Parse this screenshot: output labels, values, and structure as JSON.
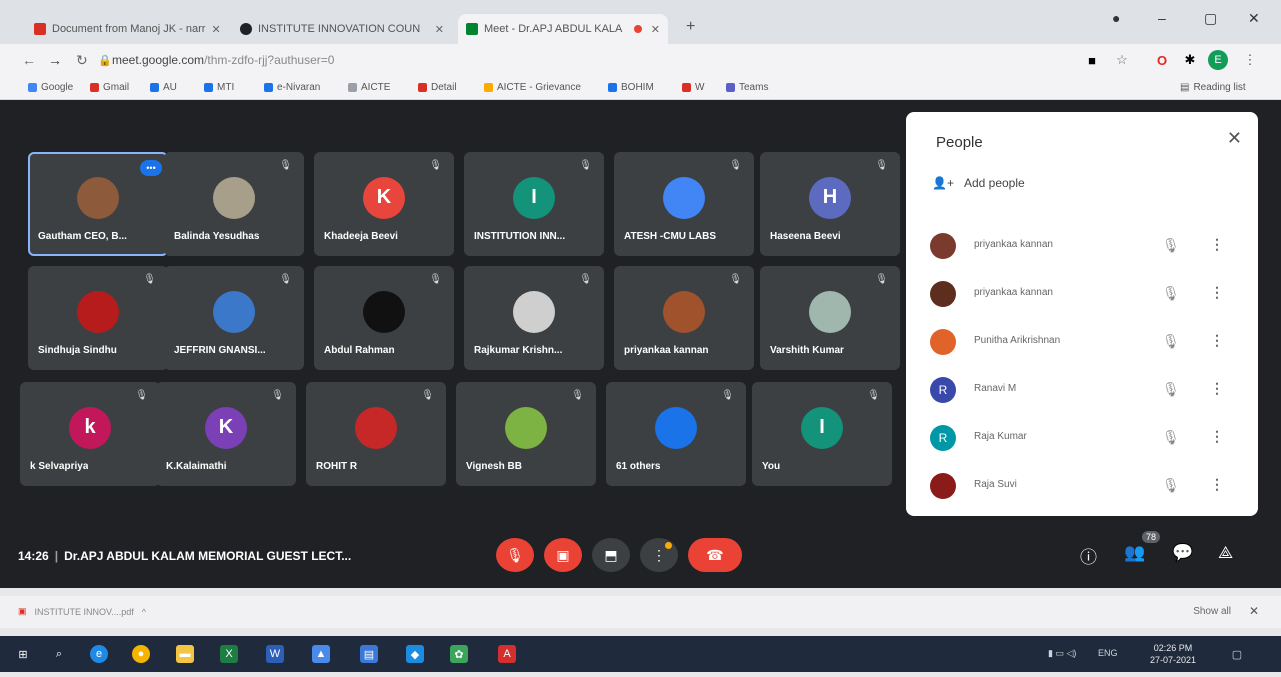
{
  "browser": {
    "tabs": [
      {
        "label": "Document from Manoj JK - narr",
        "favicon_color": "#d93025",
        "icon": "gmail-icon"
      },
      {
        "label": "INSTITUTE INNOVATION COUN",
        "favicon_color": "#202124",
        "icon": "github-icon"
      },
      {
        "label": "Meet - Dr.APJ ABDUL KALA",
        "favicon_color": "#00832d",
        "icon": "meet-icon"
      }
    ],
    "new_tab": "+",
    "window_controls": [
      "–",
      "▢",
      "✕"
    ],
    "url_host": "meet.google.com",
    "url_path": "/thm-zdfo-rjj?authuser=0",
    "profile_initial": "E",
    "reading_list": "Reading list",
    "bookmarks": [
      {
        "label": "Google",
        "color": "#4285f4"
      },
      {
        "label": "Gmail",
        "color": "#d93025"
      },
      {
        "label": "AU",
        "color": "#1a73e8"
      },
      {
        "label": "MTI",
        "color": "#1a73e8"
      },
      {
        "label": "e-Nivaran",
        "color": "#1a73e8"
      },
      {
        "label": "AICTE",
        "color": "#9aa0a6"
      },
      {
        "label": "Detail",
        "color": "#d93025"
      },
      {
        "label": "AICTE - Grievance",
        "color": "#f9ab00"
      },
      {
        "label": "BOHIM",
        "color": "#1a73e8"
      },
      {
        "label": "W",
        "color": "#d93025"
      },
      {
        "label": "Teams",
        "color": "#5b5fc7"
      }
    ]
  },
  "meet": {
    "tiles": [
      {
        "name": "Gautham CEO, B...",
        "initial": "",
        "avatar_color": "#8d5a3b",
        "self": true
      },
      {
        "name": "Balinda Yesudhas",
        "initial": "",
        "avatar_color": "#a89f8a"
      },
      {
        "name": "Khadeeja Beevi",
        "initial": "K",
        "avatar_color": "#e8453c"
      },
      {
        "name": "INSTITUTION INN...",
        "initial": "I",
        "avatar_color": "#12937a"
      },
      {
        "name": "ATESH -CMU LABS",
        "initial": "",
        "avatar_color": "#4285f4"
      },
      {
        "name": "Haseena Beevi",
        "initial": "H",
        "avatar_color": "#5c6bc0"
      },
      {
        "name": "Sindhuja Sindhu",
        "initial": "",
        "avatar_color": "#b71c1c"
      },
      {
        "name": "JEFFRIN GNANSI...",
        "initial": "",
        "avatar_color": "#3b78c9"
      },
      {
        "name": "Abdul Rahman",
        "initial": "",
        "avatar_color": "#111111"
      },
      {
        "name": "Rajkumar Krishn...",
        "initial": "",
        "avatar_color": "#cfcfcf"
      },
      {
        "name": "priyankaa kannan",
        "initial": "",
        "avatar_color": "#a0522d"
      },
      {
        "name": "Varshith Kumar",
        "initial": "",
        "avatar_color": "#9fb7ad"
      },
      {
        "name": "k Selvapriya",
        "initial": "k",
        "avatar_color": "#c2185b"
      },
      {
        "name": "K.Kalaimathi",
        "initial": "K",
        "avatar_color": "#7b3fb6"
      },
      {
        "name": "ROHIT R",
        "initial": "",
        "avatar_color": "#c62828"
      },
      {
        "name": "Vignesh BB",
        "initial": "",
        "avatar_color": "#7cb342"
      },
      {
        "name": "61 others",
        "initial": "",
        "avatar_color": "#1a73e8"
      },
      {
        "name": "You",
        "initial": "I",
        "avatar_color": "#12937a"
      }
    ],
    "more_options_badge": "•••",
    "time": "14:26",
    "meeting_title": "Dr.APJ ABDUL KALAM MEMORIAL GUEST LECT...",
    "people_count": "78"
  },
  "people_panel": {
    "title": "People",
    "add_people": "Add people",
    "participants": [
      {
        "name": "priyankaa kannan",
        "initial": "",
        "color": "#7a3b2e"
      },
      {
        "name": "priyankaa kannan",
        "initial": "",
        "color": "#5d2e1e"
      },
      {
        "name": "Punitha Arikrishnan",
        "initial": "",
        "color": "#e0632a"
      },
      {
        "name": "Ranavi M",
        "initial": "R",
        "color": "#3949ab"
      },
      {
        "name": "Raja Kumar",
        "initial": "R",
        "color": "#0097a7"
      },
      {
        "name": "Raja Suvi",
        "initial": "",
        "color": "#8b1a1a"
      }
    ]
  },
  "download_bar": {
    "file": "INSTITUTE INNOV....pdf",
    "show_all": "Show all"
  },
  "taskbar": {
    "lang": "ENG",
    "time": "02:26 PM",
    "date": "27-07-2021"
  }
}
